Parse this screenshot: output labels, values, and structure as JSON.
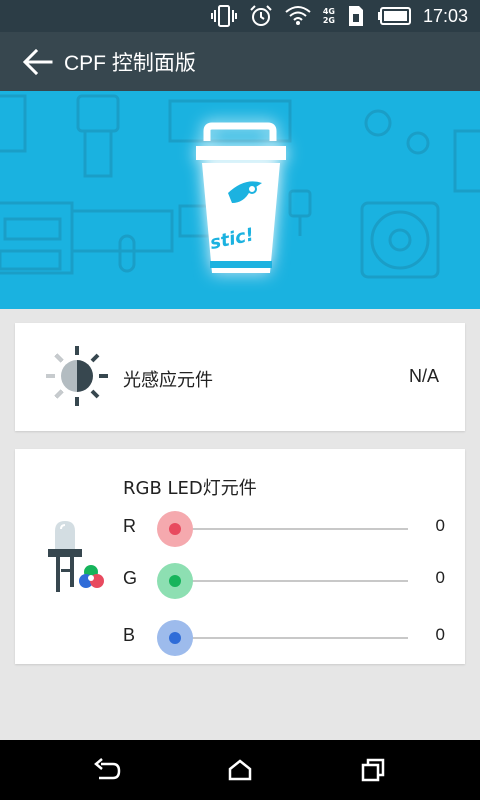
{
  "status_bar": {
    "time": "17:03",
    "signal_4g": "4G",
    "signal_2g": "2G",
    "icons": [
      "vibrate-icon",
      "alarm-icon",
      "wifi-icon",
      "cell-signal-icon",
      "sim-icon",
      "battery-icon"
    ]
  },
  "app_bar": {
    "title": "CPF 控制面版",
    "back_icon": "arrow-left-icon"
  },
  "banner": {
    "bg_color": "#1ab2e0",
    "cup_text": "stic!"
  },
  "light_sensor": {
    "label": "光感应元件",
    "value": "N/A",
    "icon": "light-sensor-icon"
  },
  "rgb_led": {
    "title": "RGB LED灯元件",
    "icon": "led-icon",
    "channels": [
      {
        "label": "R",
        "value": "0",
        "level": 0,
        "thumb_color": "#f5a9ae",
        "dot_color": "#e84a5f"
      },
      {
        "label": "G",
        "value": "0",
        "level": 0,
        "thumb_color": "#8ddfb2",
        "dot_color": "#16b45b"
      },
      {
        "label": "B",
        "value": "0",
        "level": 0,
        "thumb_color": "#9dbbec",
        "dot_color": "#2f6cd8"
      }
    ]
  },
  "nav_bar": {
    "icons": [
      "back-nav-icon",
      "home-icon",
      "recents-icon"
    ]
  }
}
